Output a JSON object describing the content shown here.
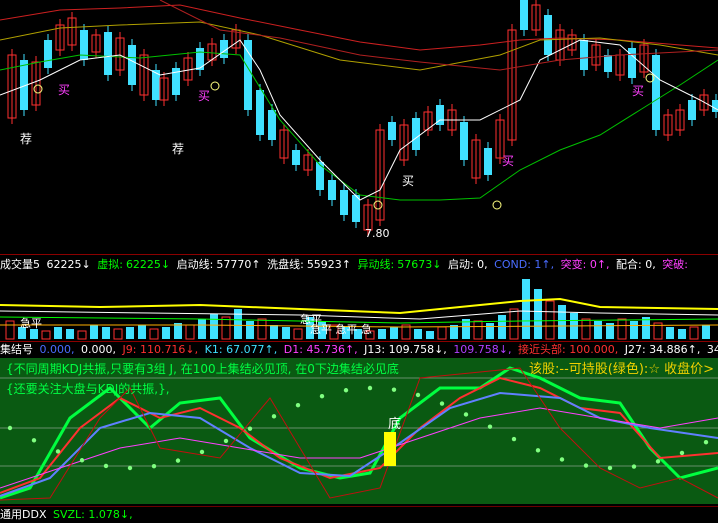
{
  "price_pane": {
    "markers": [
      {
        "text": "买",
        "color": "#ff40ff"
      },
      {
        "text": "买",
        "color": "#ff40ff"
      },
      {
        "text": "买",
        "color": "#ff40ff"
      },
      {
        "text": "买",
        "color": "#ff40ff"
      },
      {
        "text": "买",
        "color": "#ffffff"
      },
      {
        "text": "荐",
        "color": "#ffffff"
      },
      {
        "text": "荐",
        "color": "#ffffff"
      }
    ],
    "low_label": "7.80"
  },
  "volume_header": {
    "title": "成交量5",
    "value": "62225↓",
    "xuni_label": "虚拟:",
    "xuni_value": "62225↓",
    "qidong_label": "启动线:",
    "qidong_value": "57770↑",
    "xipan_label": "洗盘线:",
    "xipan_value": "55923↑",
    "yidong_label": "异动线:",
    "yidong_value": "57673↓",
    "start_label": "启动: 0,",
    "cond_label": "COND: 1↑,",
    "tubian_label": "突变: 0↑,",
    "peihe_label": "配合: 0,",
    "tupo_label": "突破:"
  },
  "volume_pane": {
    "labels": [
      "急平",
      "急平",
      "急平 急平 急"
    ]
  },
  "kdj_header": {
    "title": "集结号",
    "v1": "0.000,",
    "v2": "0.000,",
    "j9": "J9: 110.716↓,",
    "k1": "K1: 67.077↑,",
    "d1": "D1: 45.736↑,",
    "j13": "J13: 109.758↓,",
    "j13b": "109.758↓,",
    "top": "接近头部: 100.000,",
    "j27": "J27: 34.886↑,",
    "last": "34."
  },
  "kdj_pane": {
    "note_line1": "{不同周期KDJ共振,只要有3组 J, 在100上集结必见顶, 在0下边集结必见底",
    "note_line2": "{还要关注大盘与KDJ的共振,},",
    "hold_note": "该股:--可持股(绿色):☆  收盘价>",
    "bottom_label": "底"
  },
  "ddx_header": {
    "title": "通用DDX",
    "svzl": "SVZL: 1.078↓,"
  },
  "colors": {
    "up": "#ff3030",
    "down": "#40e0ff",
    "ma_white": "#ffffff",
    "ma_green": "#00cc00",
    "ma_red": "#cc0000",
    "kdj_bg": "#0a5a12"
  }
}
